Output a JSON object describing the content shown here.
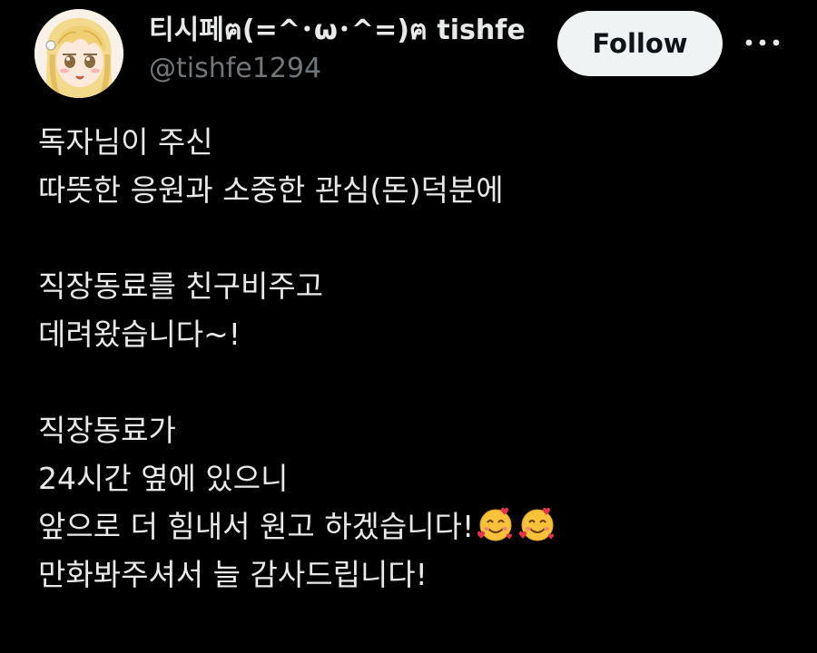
{
  "author": {
    "display_name": "티시페ฅ(=^･ω･^=)ฅ tishfe",
    "handle": "@tishfe1294",
    "avatar": "anime-girl-avatar"
  },
  "actions": {
    "follow_label": "Follow",
    "more_icon": "more-horizontal-icon"
  },
  "post": {
    "lines": [
      "독자님이 주신",
      "따뜻한 응원과 소중한 관심(돈)덕분에",
      "",
      "직장동료를 친구비주고",
      "데려왔습니다~!",
      "",
      "직장동료가",
      "24시간 옆에 있으니",
      "앞으로 더 힘내서 원고 하겠습니다!",
      "만화봐주셔서 늘 감사드립니다!"
    ],
    "emoji": "smiling-face-with-hearts"
  },
  "colors": {
    "background": "#000000",
    "text": "#e7e9ea",
    "secondary_text": "#71767b",
    "button_bg": "#eff3f4",
    "button_text": "#0f1419"
  }
}
